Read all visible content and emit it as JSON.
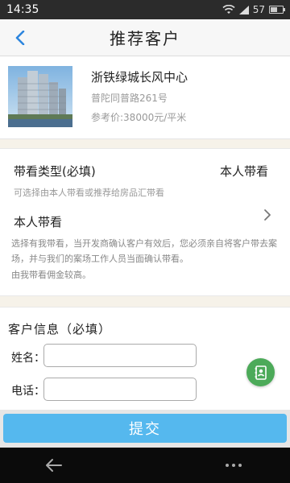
{
  "status_bar": {
    "time": "14:35",
    "battery": "57",
    "battery_level": 0.57
  },
  "nav": {
    "title": "推荐客户"
  },
  "property": {
    "name": "浙铁绿城长风中心",
    "address": "普陀同普路261号",
    "price": "参考价:38000元/平米"
  },
  "viewing": {
    "type_label": "带看类型(必填)",
    "type_value": "本人带看",
    "type_hint": "可选择由本人带看或推荐给房品汇带看",
    "option_title": "本人带看",
    "option_desc": "选择有我带看，当开发商确认客户有效后，您必须亲自将客户带去案场，并与我们的案场工作人员当面确认带看。",
    "option_note": "由我带看佣金较高。"
  },
  "customer": {
    "heading": "客户信息（必填）",
    "name_label": "姓名：",
    "name_value": "",
    "phone_label": "电话：",
    "phone_value": ""
  },
  "submit_label": "提交",
  "colors": {
    "accent": "#55b8ee",
    "contact_fab": "#4caa59",
    "nav_icon": "#2e86de"
  },
  "icons": {
    "back": "chevron-left-icon",
    "chevron": "chevron-right-icon",
    "contact": "contact-book-icon"
  }
}
